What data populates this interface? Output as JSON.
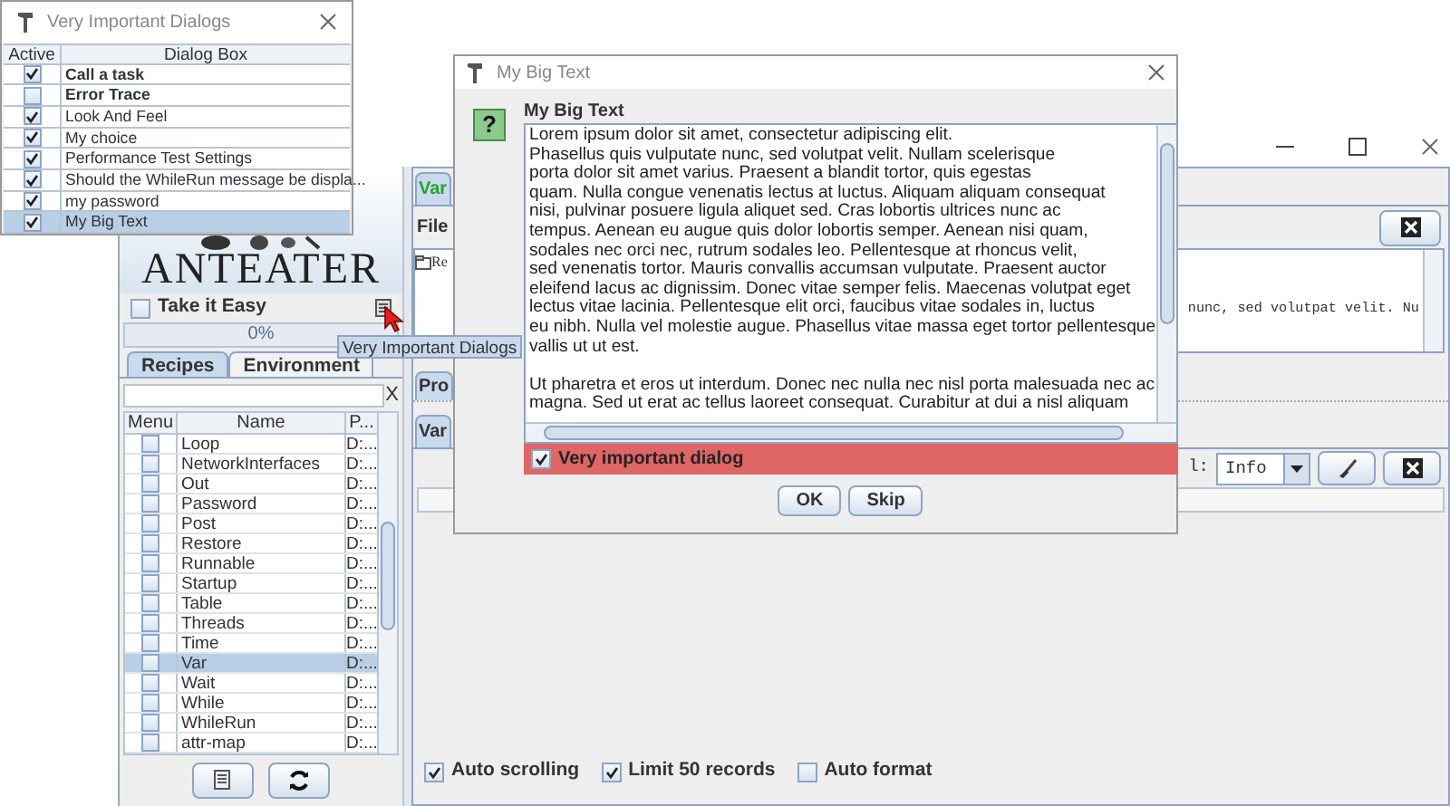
{
  "dialogs_window": {
    "title": "Very Important Dialogs",
    "columns": [
      "Active",
      "Dialog Box"
    ],
    "rows": [
      {
        "label": "Call a task",
        "active": true,
        "bold": true,
        "selected": false
      },
      {
        "label": "Error Trace",
        "active": false,
        "bold": true,
        "selected": false
      },
      {
        "label": "Look And Feel",
        "active": true,
        "bold": false,
        "selected": false
      },
      {
        "label": "My choice",
        "active": true,
        "bold": false,
        "selected": false
      },
      {
        "label": "Performance Test Settings",
        "active": true,
        "bold": false,
        "selected": false
      },
      {
        "label": "Should the WhileRun message be displa...",
        "active": true,
        "bold": false,
        "selected": false
      },
      {
        "label": "my password",
        "active": true,
        "bold": false,
        "selected": false
      },
      {
        "label": "My Big Text",
        "active": true,
        "bold": false,
        "selected": true
      }
    ]
  },
  "main_window": {
    "logo_text": "ANTEATER",
    "take_it_easy": {
      "label": "Take it Easy",
      "checked": false
    },
    "progress": {
      "label": "0%",
      "level": 0
    },
    "tooltip": "Very Important Dialogs",
    "left_tabs": [
      {
        "label": "Recipes",
        "selected": true
      },
      {
        "label": "Environment",
        "selected": false
      }
    ],
    "search_clear": "X",
    "recipe_columns": [
      "Menu",
      "Name",
      "P..."
    ],
    "recipes": [
      {
        "name": "Loop",
        "path": "D:...",
        "in_menu": false,
        "selected": false
      },
      {
        "name": "NetworkInterfaces",
        "path": "D:...",
        "in_menu": false,
        "selected": false
      },
      {
        "name": "Out",
        "path": "D:...",
        "in_menu": false,
        "selected": false
      },
      {
        "name": "Password",
        "path": "D:...",
        "in_menu": false,
        "selected": false
      },
      {
        "name": "Post",
        "path": "D:...",
        "in_menu": false,
        "selected": false
      },
      {
        "name": "Restore",
        "path": "D:...",
        "in_menu": false,
        "selected": false
      },
      {
        "name": "Runnable",
        "path": "D:...",
        "in_menu": false,
        "selected": false
      },
      {
        "name": "Startup",
        "path": "D:...",
        "in_menu": false,
        "selected": false
      },
      {
        "name": "Table",
        "path": "D:...",
        "in_menu": false,
        "selected": false
      },
      {
        "name": "Threads",
        "path": "D:...",
        "in_menu": false,
        "selected": false
      },
      {
        "name": "Time",
        "path": "D:...",
        "in_menu": false,
        "selected": false
      },
      {
        "name": "Var",
        "path": "D:...",
        "in_menu": false,
        "selected": true
      },
      {
        "name": "Wait",
        "path": "D:...",
        "in_menu": false,
        "selected": false
      },
      {
        "name": "While",
        "path": "D:...",
        "in_menu": false,
        "selected": false
      },
      {
        "name": "WhileRun",
        "path": "D:...",
        "in_menu": false,
        "selected": false
      },
      {
        "name": "attr-map",
        "path": "D:...",
        "in_menu": false,
        "selected": false
      }
    ],
    "top_tab": "Var",
    "file_button": "File",
    "tree_item": "Re",
    "sub_tab": "Pro",
    "log_tab": "Var",
    "console_text": "nunc, sed volutpat velit. Nu",
    "level_label": "l:",
    "level_value": "Info",
    "options": [
      {
        "label": "Auto scrolling",
        "checked": true
      },
      {
        "label": "Limit 50 records",
        "checked": true
      },
      {
        "label": "Auto format",
        "checked": false
      }
    ]
  },
  "big_text_dialog": {
    "title": "My Big Text",
    "help_icon": "?",
    "heading": "My Big Text",
    "paragraphs": [
      [
        "Lorem ipsum dolor sit amet, consectetur adipiscing elit.",
        "Phasellus quis vulputate nunc, sed volutpat velit. Nullam scelerisque",
        "porta dolor sit amet varius. Praesent a blandit tortor, quis egestas",
        "quam. Nulla congue venenatis lectus at luctus. Aliquam aliquam consequat",
        "nisi, pulvinar posuere ligula aliquet sed. Cras lobortis ultrices nunc ac",
        "tempus. Aenean eu augue quis dolor lobortis semper. Aenean nisi quam,",
        "sodales nec orci nec, rutrum sodales leo. Pellentesque at rhoncus velit,",
        "sed venenatis tortor. Mauris convallis accumsan vulputate. Praesent auctor",
        "eleifend lacus ac dignissim. Donec vitae semper felis. Maecenas volutpat eget",
        "lectus vitae lacinia. Pellentesque elit orci, faucibus vitae sodales in, luctus",
        "eu nibh. Nulla vel molestie augue. Phasellus vitae massa eget tortor pellentesque",
        "vallis ut ut est."
      ],
      [
        "Ut pharetra et eros ut interdum. Donec nec nulla nec nisl porta malesuada nec ac",
        "magna. Sed ut erat ac tellus laoreet consequat. Curabitur at dui a nisl aliquam"
      ]
    ],
    "important": {
      "label": "Very important dialog",
      "checked": true
    },
    "buttons": [
      "OK",
      "Skip"
    ]
  }
}
